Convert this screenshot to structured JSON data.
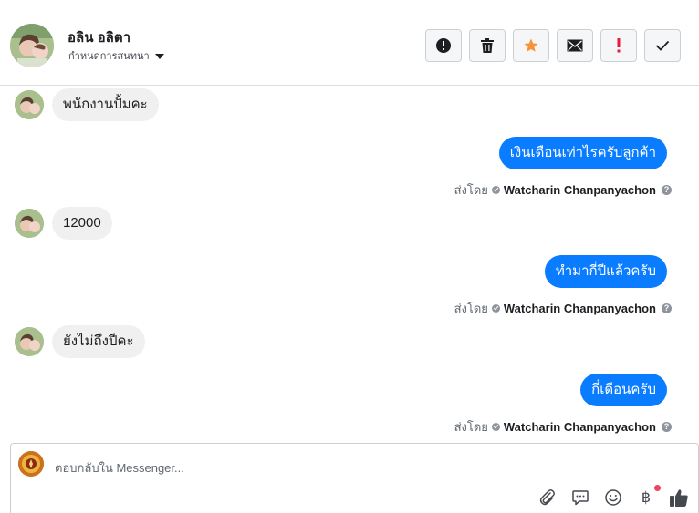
{
  "header": {
    "contact_name": "อลิน อลิตา",
    "assign_label": "กำหนดการสนทนา"
  },
  "actions": [
    {
      "name": "report-button",
      "icon": "exclamation-circle-icon"
    },
    {
      "name": "delete-button",
      "icon": "trash-icon"
    },
    {
      "name": "star-button",
      "icon": "star-icon",
      "color": "#f7923b"
    },
    {
      "name": "mark-unread-button",
      "icon": "envelope-icon"
    },
    {
      "name": "follow-up-button",
      "icon": "red-exclamation-icon",
      "color": "#e41e3f"
    },
    {
      "name": "mark-done-button",
      "icon": "checkmark-icon"
    }
  ],
  "messages": [
    {
      "direction": "in",
      "text": "พนักงานปั้มคะ"
    },
    {
      "direction": "out",
      "text": "เงินเดือนเท่าไรครับลูกค้า",
      "sent_by_label": "ส่งโดย",
      "sender": "Watcharin Chanpanyachon"
    },
    {
      "direction": "in",
      "text": "12000"
    },
    {
      "direction": "out",
      "text": "ทำมากี่ปีแล้วครับ",
      "sent_by_label": "ส่งโดย",
      "sender": "Watcharin Chanpanyachon"
    },
    {
      "direction": "in",
      "text": "ยังไม่ถึงปีคะ"
    },
    {
      "direction": "out",
      "text": "กี่เดือนครับ",
      "sent_by_label": "ส่งโดย",
      "sender": "Watcharin Chanpanyachon"
    }
  ],
  "composer": {
    "placeholder": "ตอบกลับใน Messenger...",
    "tools": [
      "paperclip-icon",
      "saved-reply-icon",
      "emoji-icon",
      "baht-payment-icon",
      "thumbs-up-icon"
    ],
    "currency_symbol": "฿"
  },
  "colors": {
    "outgoing_bubble": "#0a7cff",
    "incoming_bubble": "#f0f0f0",
    "star": "#f7923b",
    "alert": "#e41e3f",
    "notification_dot": "#f3425f"
  }
}
